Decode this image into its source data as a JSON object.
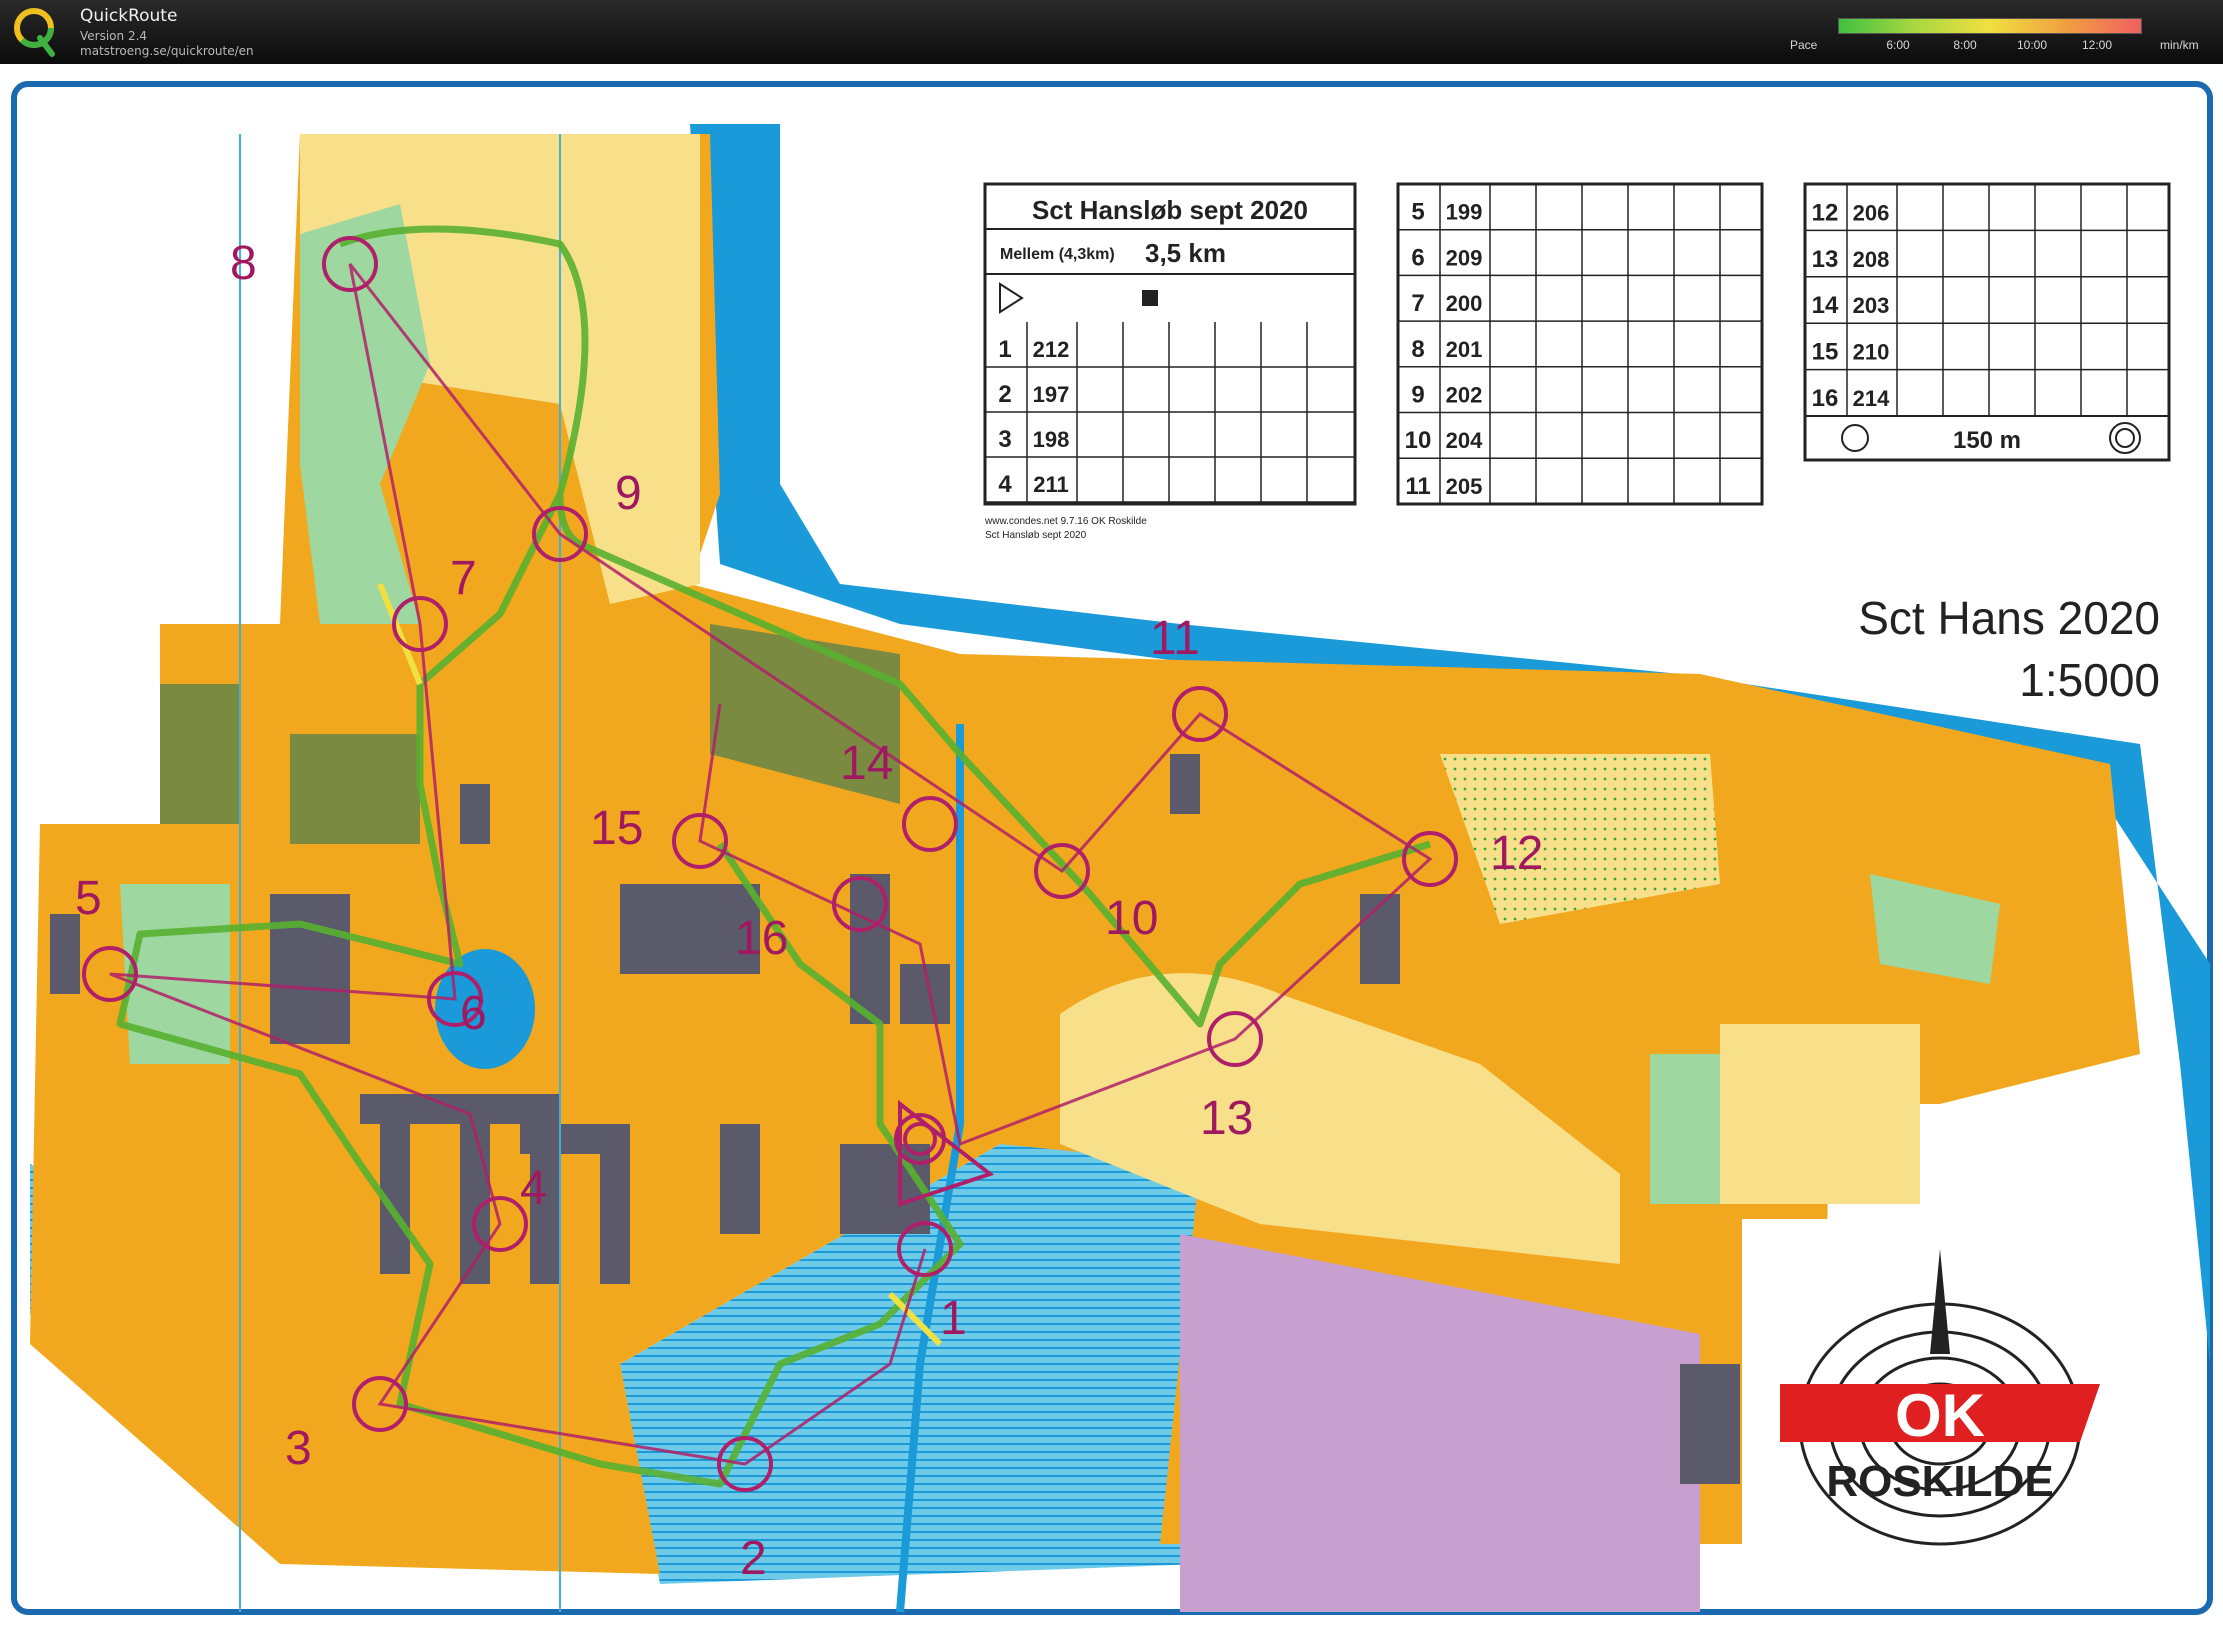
{
  "app": {
    "name": "QuickRoute",
    "version": "Version 2.4",
    "url": "matstroeng.se/quickroute/en"
  },
  "pace_legend": {
    "label": "Pace",
    "ticks": [
      "6:00",
      "8:00",
      "10:00",
      "12:00"
    ],
    "unit": "min/km",
    "colors": [
      "#40c040",
      "#a8d840",
      "#f0e040",
      "#f0a040",
      "#f06060"
    ]
  },
  "map": {
    "title_line1": "Sct Hans 2020",
    "title_line2": "1:5000",
    "club_logo_text": "ROSKILDE",
    "club_logo_mark": "OK",
    "footer_line1": "www.condes.net 9.7.16 OK Roskilde",
    "footer_line2": "Sct Hansløb sept 2020",
    "colors": {
      "water": "#1a9ad8",
      "open_land": "#f8e08a",
      "rough_open": "#f2a81e",
      "forest": "#ffffff",
      "green": "#9ed8a0",
      "building": "#5a5a6a",
      "olive": "#7a8a40",
      "restricted": "#c8a0d0",
      "course": "#b0206a",
      "route": "#58b030",
      "route_yellow": "#f0e040"
    }
  },
  "description_sheet": {
    "title": "Sct Hansløb sept 2020",
    "class": "Mellem (4,3km)",
    "length": "3,5 km",
    "start_row": {
      "num": "",
      "code": ""
    },
    "controls_a": [
      {
        "num": "1",
        "code": "212"
      },
      {
        "num": "2",
        "code": "197"
      },
      {
        "num": "3",
        "code": "198"
      },
      {
        "num": "4",
        "code": "211"
      }
    ],
    "controls_b": [
      {
        "num": "5",
        "code": "199"
      },
      {
        "num": "6",
        "code": "209"
      },
      {
        "num": "7",
        "code": "200"
      },
      {
        "num": "8",
        "code": "201"
      },
      {
        "num": "9",
        "code": "202"
      },
      {
        "num": "10",
        "code": "204"
      },
      {
        "num": "11",
        "code": "205"
      }
    ],
    "controls_c": [
      {
        "num": "12",
        "code": "206"
      },
      {
        "num": "13",
        "code": "208"
      },
      {
        "num": "14",
        "code": "203"
      },
      {
        "num": "15",
        "code": "210"
      },
      {
        "num": "16",
        "code": "214"
      }
    ],
    "finish_distance": "150 m"
  },
  "controls": [
    {
      "num": "1",
      "map_label": "1"
    },
    {
      "num": "2",
      "map_label": "2"
    },
    {
      "num": "3",
      "map_label": "3"
    },
    {
      "num": "4",
      "map_label": "4"
    },
    {
      "num": "5",
      "map_label": "5"
    },
    {
      "num": "6",
      "map_label": "6"
    },
    {
      "num": "7",
      "map_label": "7"
    },
    {
      "num": "8",
      "map_label": "8"
    },
    {
      "num": "9",
      "map_label": "9"
    },
    {
      "num": "10",
      "map_label": "10"
    },
    {
      "num": "11",
      "map_label": "11"
    },
    {
      "num": "12",
      "map_label": "12"
    },
    {
      "num": "13",
      "map_label": "13"
    },
    {
      "num": "14",
      "map_label": "14"
    },
    {
      "num": "15",
      "map_label": "15"
    },
    {
      "num": "16",
      "map_label": "16"
    }
  ]
}
